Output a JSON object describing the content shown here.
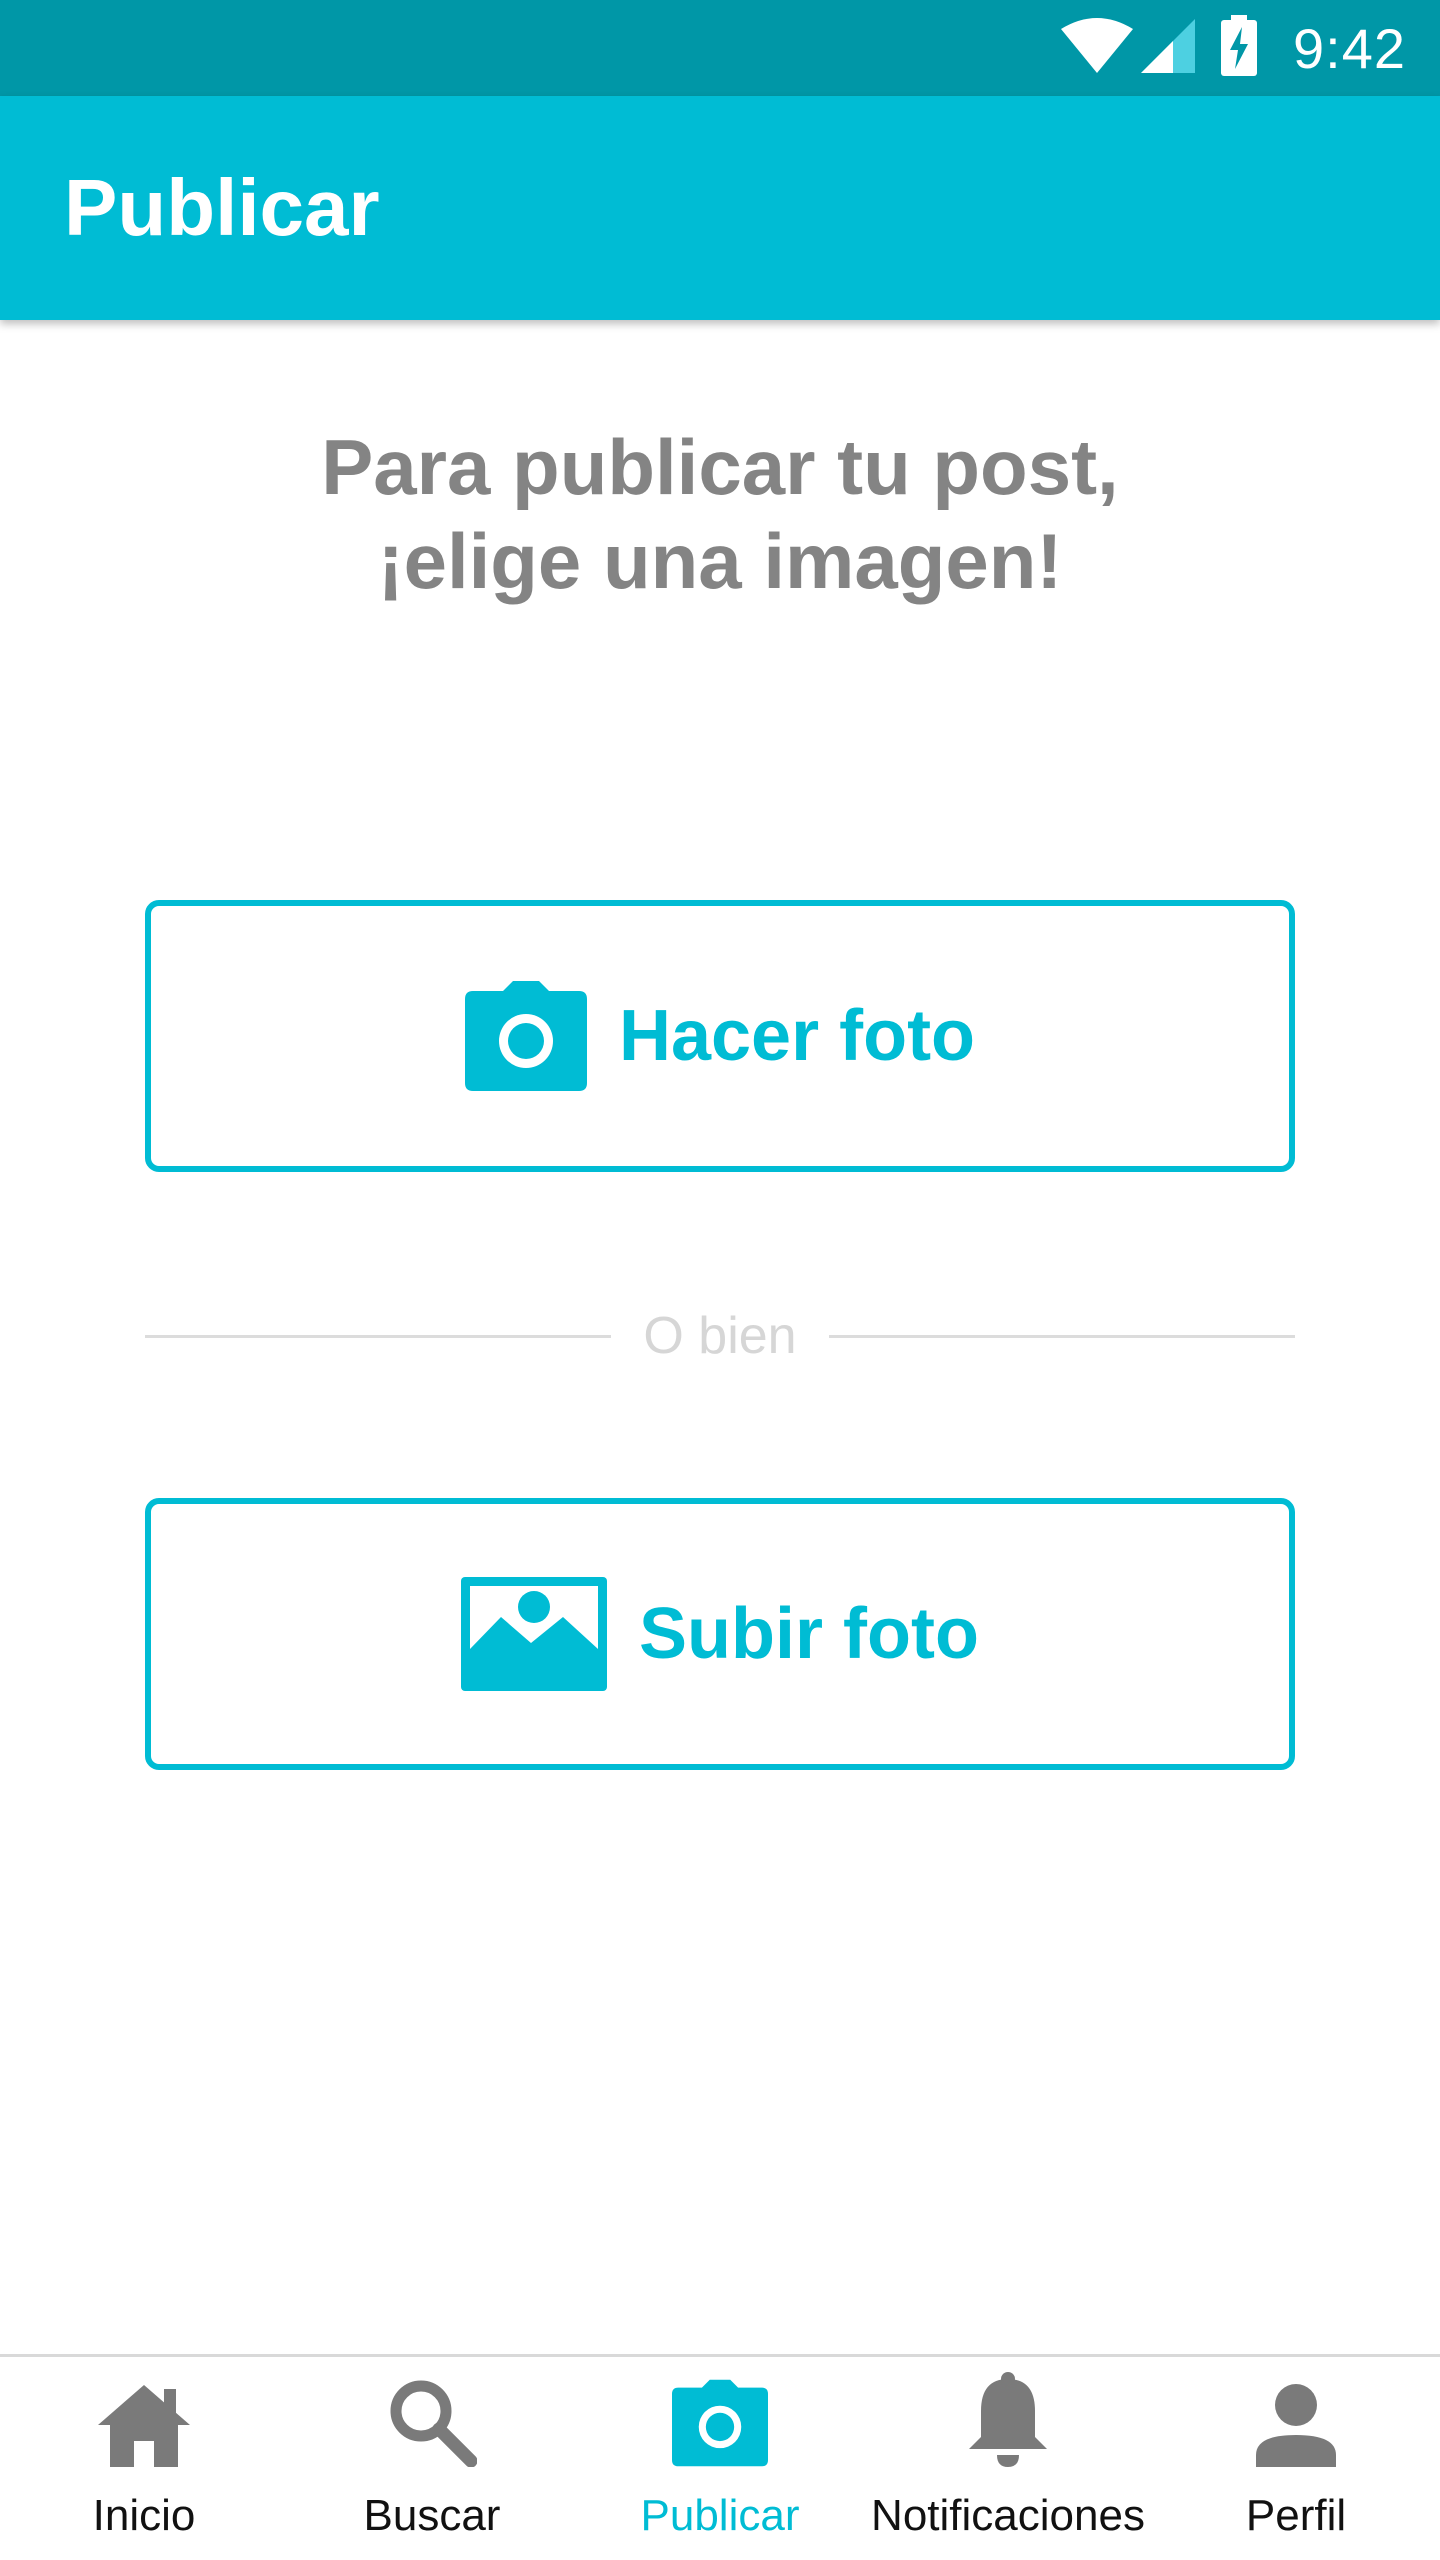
{
  "status_bar": {
    "time": "9:42",
    "icons": [
      "wifi-icon",
      "cell-signal-icon",
      "battery-charging-icon"
    ]
  },
  "app_bar": {
    "title": "Publicar"
  },
  "main": {
    "prompt_line1": "Para publicar tu post,",
    "prompt_line2": "¡elige una imagen!",
    "take_photo": {
      "label": "Hacer foto",
      "icon": "camera-icon"
    },
    "divider_text": "O bien",
    "upload_photo": {
      "label": "Subir foto",
      "icon": "image-icon"
    }
  },
  "bottom_nav": {
    "items": [
      {
        "label": "Inicio",
        "icon": "home-icon",
        "active": false
      },
      {
        "label": "Buscar",
        "icon": "search-icon",
        "active": false
      },
      {
        "label": "Publicar",
        "icon": "camera-icon",
        "active": true
      },
      {
        "label": "Notificaciones",
        "icon": "bell-icon",
        "active": false
      },
      {
        "label": "Perfil",
        "icon": "person-icon",
        "active": false
      }
    ]
  },
  "colors": {
    "primary": "#00bcd4",
    "primary_dark": "#0097a7",
    "prompt_text": "#848484",
    "divider_text": "#d6d6d6",
    "nav_icon": "#7a7a7a"
  }
}
